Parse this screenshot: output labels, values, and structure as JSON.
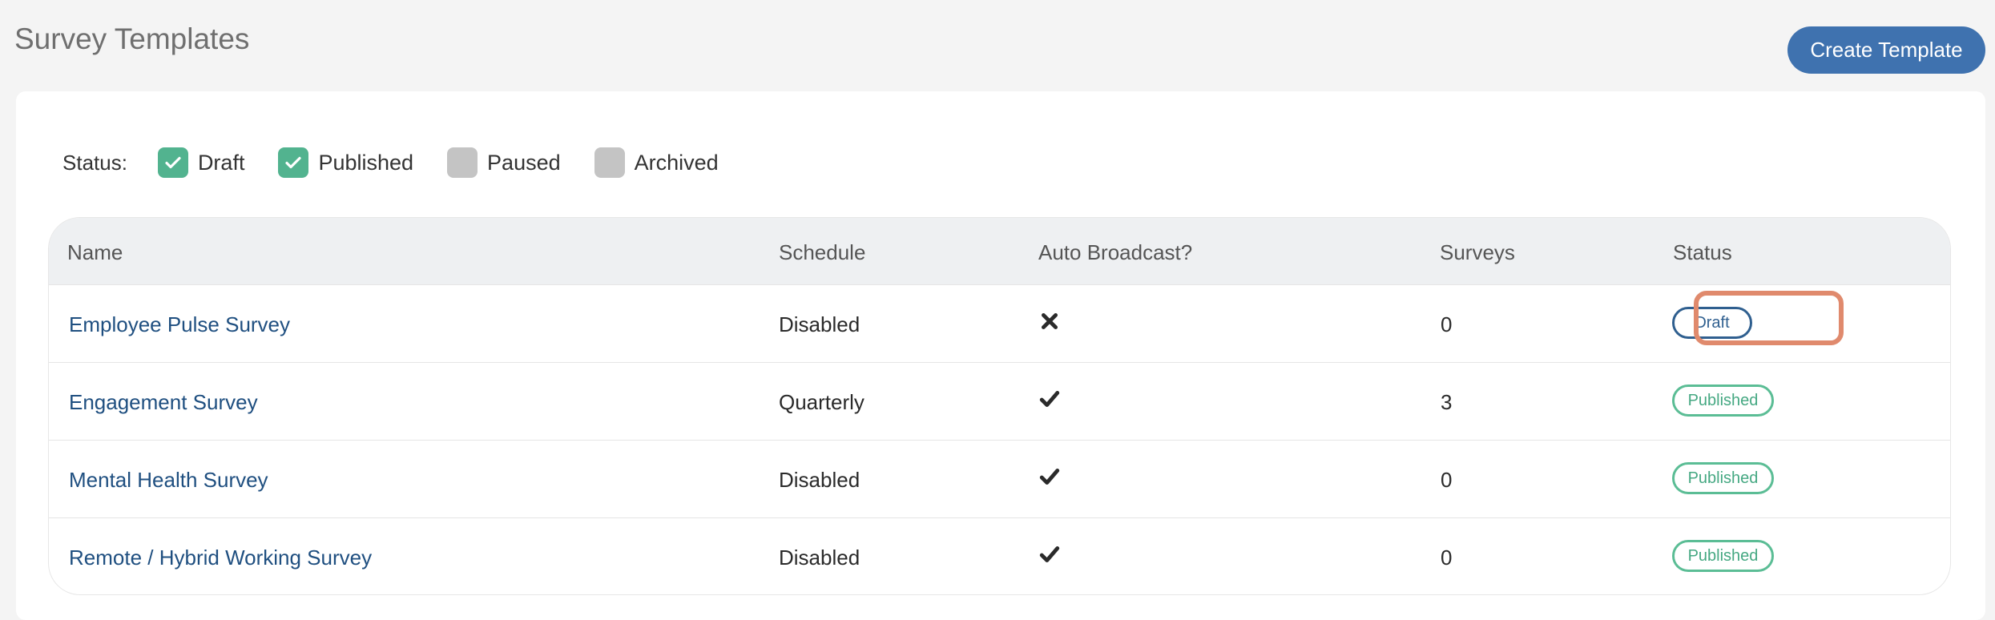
{
  "header": {
    "title": "Survey Templates",
    "create_button": "Create Template"
  },
  "filters": {
    "label": "Status:",
    "items": [
      {
        "label": "Draft",
        "checked": true
      },
      {
        "label": "Published",
        "checked": true
      },
      {
        "label": "Paused",
        "checked": false
      },
      {
        "label": "Archived",
        "checked": false
      }
    ]
  },
  "table": {
    "columns": [
      "Name",
      "Schedule",
      "Auto Broadcast?",
      "Surveys",
      "Status"
    ],
    "rows": [
      {
        "name": "Employee Pulse Survey",
        "schedule": "Disabled",
        "auto_broadcast": "x-icon",
        "surveys": "0",
        "status": "Draft"
      },
      {
        "name": "Engagement Survey",
        "schedule": "Quarterly",
        "auto_broadcast": "check-icon",
        "surveys": "3",
        "status": "Published"
      },
      {
        "name": "Mental Health Survey",
        "schedule": "Disabled",
        "auto_broadcast": "check-icon",
        "surveys": "0",
        "status": "Published"
      },
      {
        "name": "Remote / Hybrid Working Survey",
        "schedule": "Disabled",
        "auto_broadcast": "check-icon",
        "surveys": "0",
        "status": "Published"
      }
    ]
  },
  "colors": {
    "accent": "#3f72af",
    "checked": "#52b38f",
    "published": "#5bbd95",
    "draft": "#2f5f8f",
    "highlight": "#e08a6d"
  }
}
